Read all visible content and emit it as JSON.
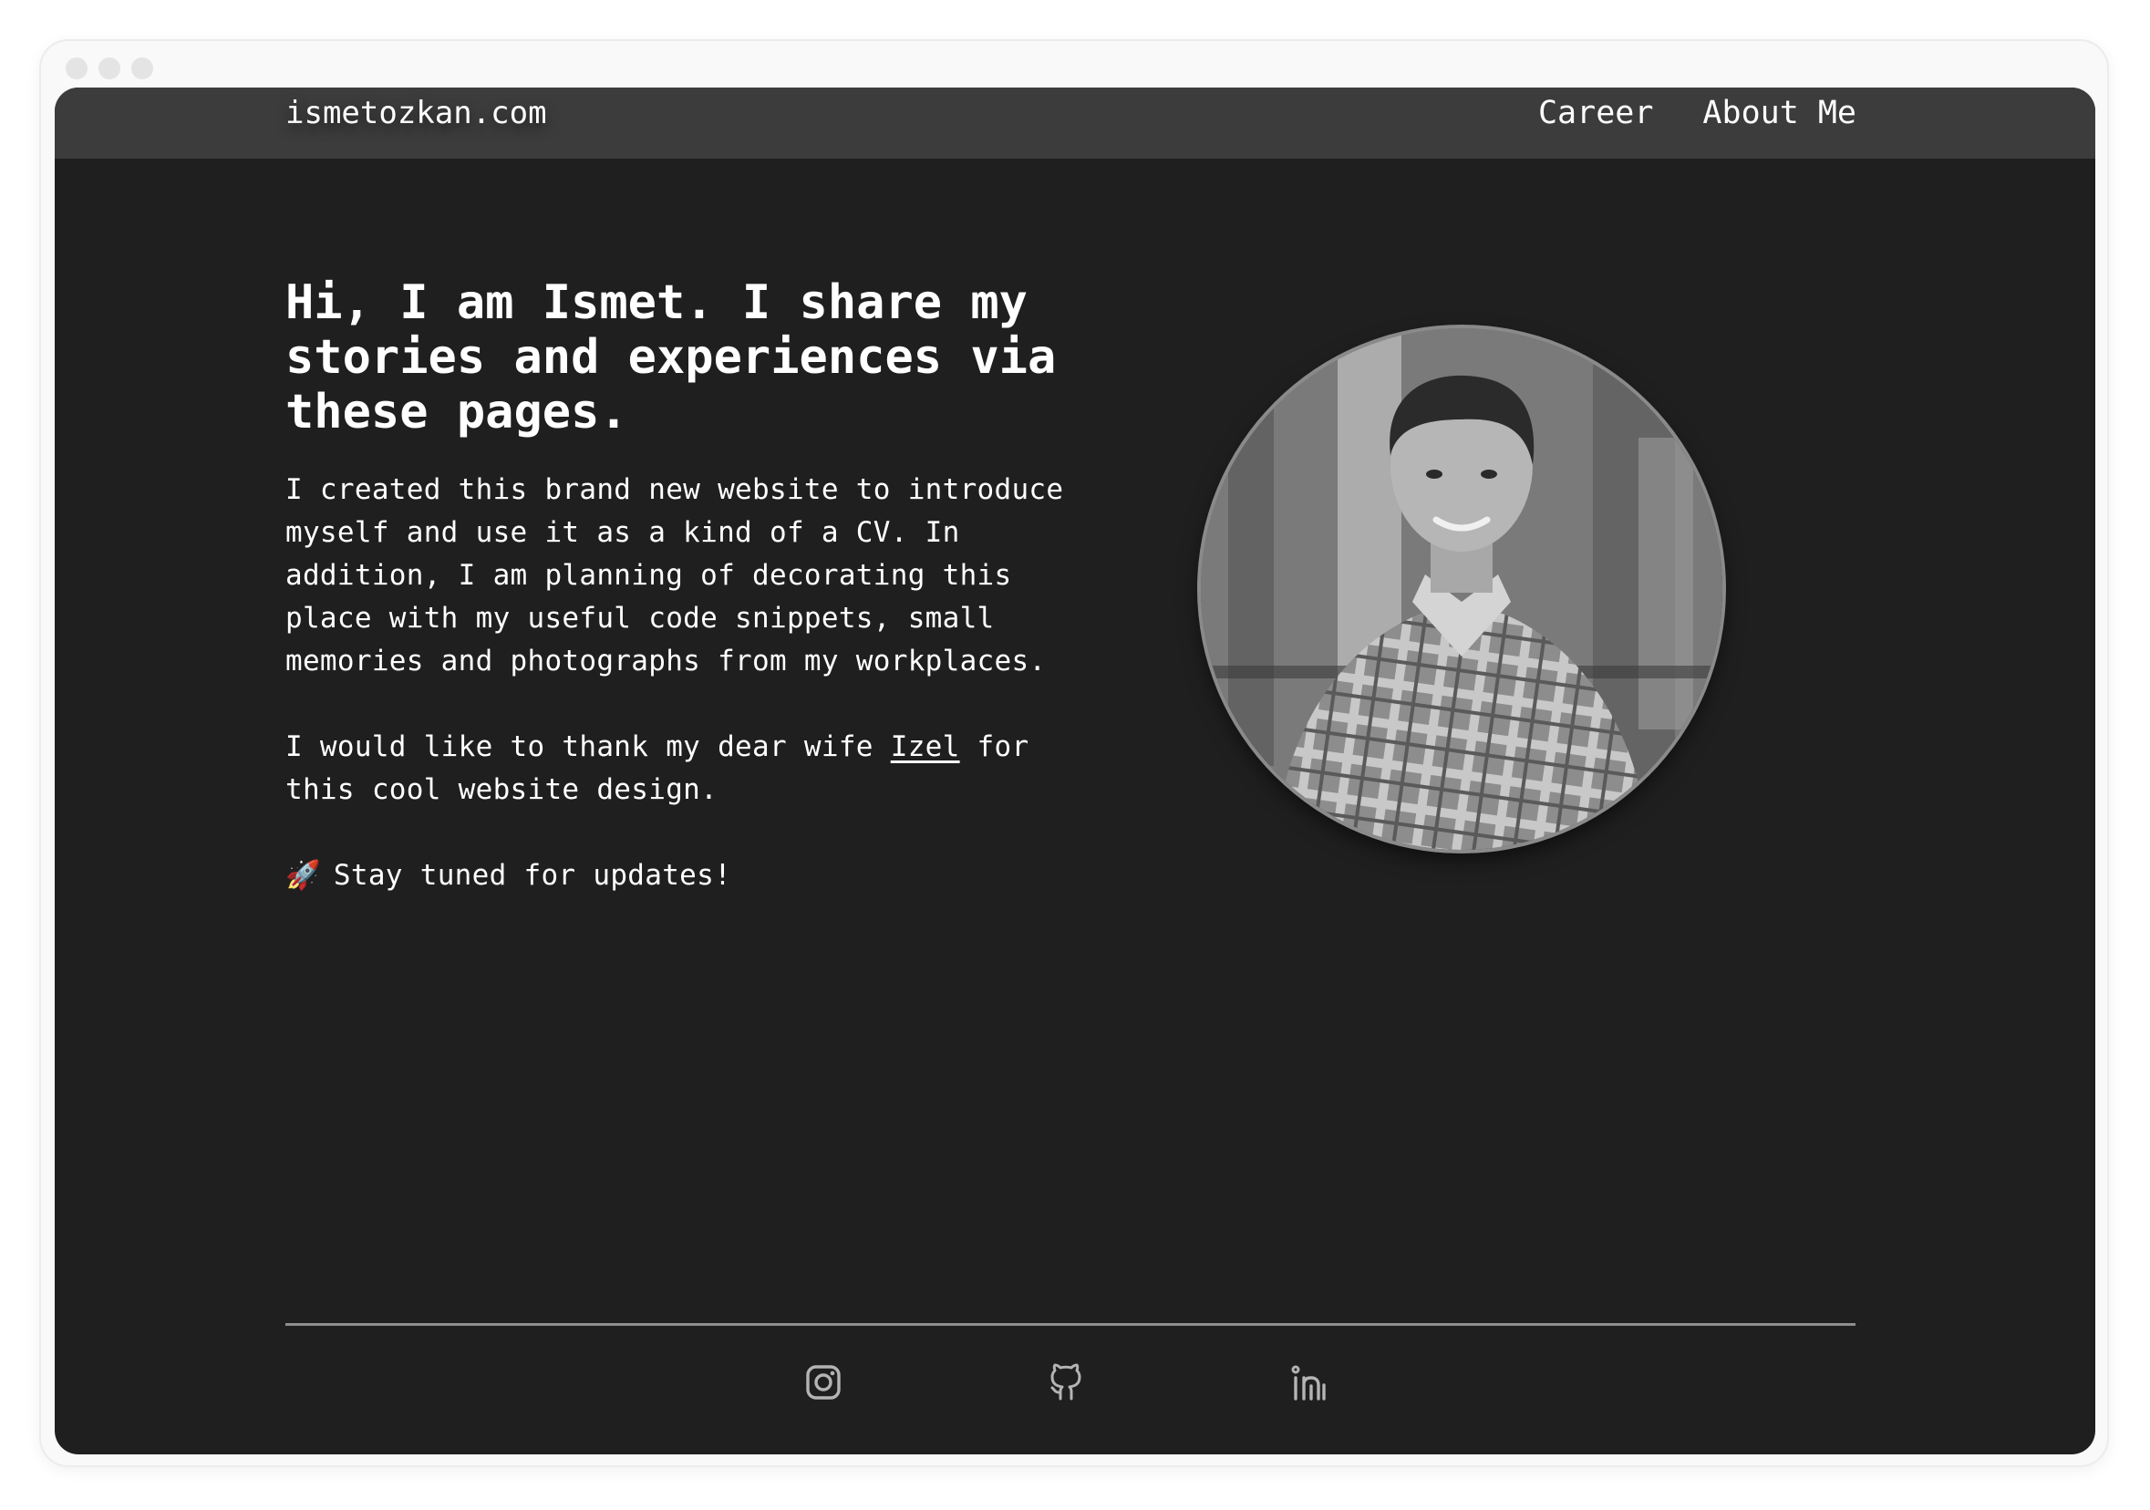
{
  "header": {
    "brand": "ismetozkan.com",
    "nav": [
      {
        "label": "Career"
      },
      {
        "label": "About Me"
      }
    ]
  },
  "hero": {
    "title": "Hi, I am Ismet. I share my stories and experiences via these pages.",
    "paragraph1": "I created this brand new website to introduce myself and use it as a kind of a CV. In addition, I am planning of decorating this place with my useful code snippets, small memories and photographs from my workplaces.",
    "thanks_before": "I would like to thank my dear wife ",
    "thanks_link": "Izel",
    "thanks_after": " for this cool website design.",
    "rocket": "🚀",
    "cta": "Stay tuned for updates!"
  },
  "portrait": {
    "icon": "person-photo"
  },
  "footer": {
    "social": [
      {
        "icon": "instagram-icon"
      },
      {
        "icon": "github-icon"
      },
      {
        "icon": "linkedin-icon"
      }
    ]
  },
  "colors": {
    "page_bg": "#1f1f1f",
    "topbar_bg": "#3c3c3c",
    "text": "#ffffff",
    "icon": "#b4b4b4",
    "divider": "#8e8e8e"
  }
}
